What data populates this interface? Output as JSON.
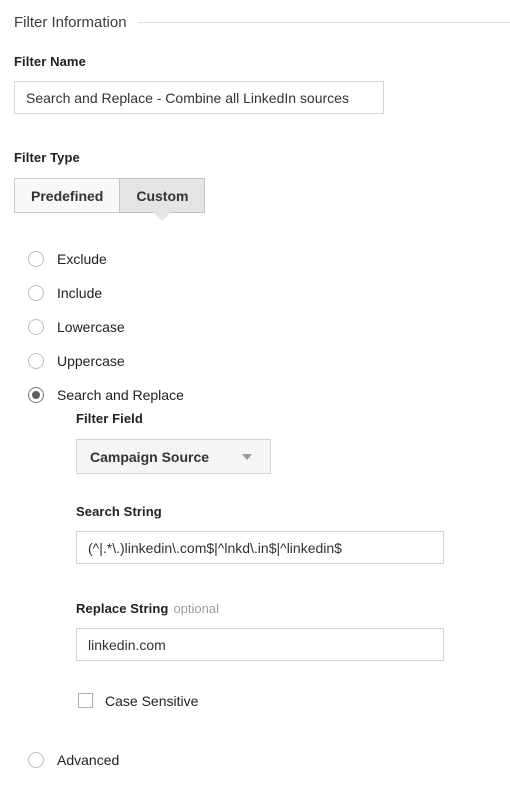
{
  "section": {
    "title": "Filter Information"
  },
  "filter_name": {
    "label": "Filter Name",
    "value": "Search and Replace - Combine all LinkedIn sources",
    "placeholder": ""
  },
  "filter_type": {
    "label": "Filter Type",
    "tabs": [
      {
        "label": "Predefined",
        "selected": false
      },
      {
        "label": "Custom",
        "selected": true
      }
    ]
  },
  "custom_options": {
    "radios": [
      {
        "label": "Exclude",
        "selected": false
      },
      {
        "label": "Include",
        "selected": false
      },
      {
        "label": "Lowercase",
        "selected": false
      },
      {
        "label": "Uppercase",
        "selected": false
      },
      {
        "label": "Search and Replace",
        "selected": true
      }
    ],
    "advanced": {
      "label": "Advanced",
      "selected": false
    }
  },
  "search_and_replace": {
    "filter_field": {
      "label": "Filter Field",
      "value": "Campaign Source"
    },
    "search_string": {
      "label": "Search String",
      "value": "(^|.*\\.)linkedin\\.com$|^lnkd\\.in$|^linkedin$",
      "placeholder": ""
    },
    "replace_string": {
      "label": "Replace String",
      "optional_tag": "optional",
      "value": "linkedin.com",
      "placeholder": ""
    },
    "case_sensitive": {
      "label": "Case Sensitive",
      "checked": false
    }
  }
}
